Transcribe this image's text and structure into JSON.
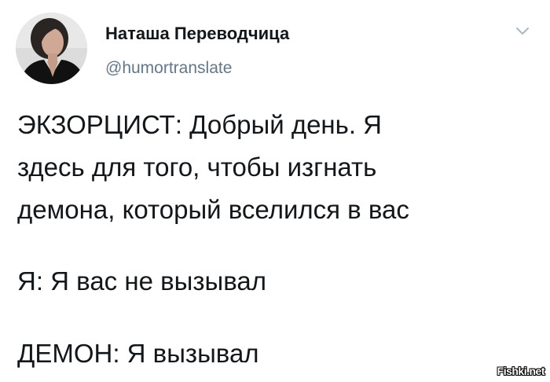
{
  "tweet": {
    "author": {
      "display_name": "Наташа Переводчица",
      "handle": "@humortranslate",
      "avatar_icon": "user-avatar-photo"
    },
    "menu_icon": "chevron-down-icon",
    "body": {
      "paragraph_1_line_1": "ЭКЗОРЦИСТ: Добрый день. Я",
      "paragraph_1_line_2": "здесь для того, чтобы изгнать",
      "paragraph_1_line_3": "демона, который вселился в вас",
      "paragraph_2": "Я: Я вас не вызывал",
      "paragraph_3": "ДЕМОН: Я вызывал"
    }
  },
  "watermark": {
    "text": "Fishki.net"
  },
  "colors": {
    "text_primary": "#14171a",
    "text_secondary": "#657786",
    "background": "#ffffff",
    "caret": "#aab8c2"
  }
}
